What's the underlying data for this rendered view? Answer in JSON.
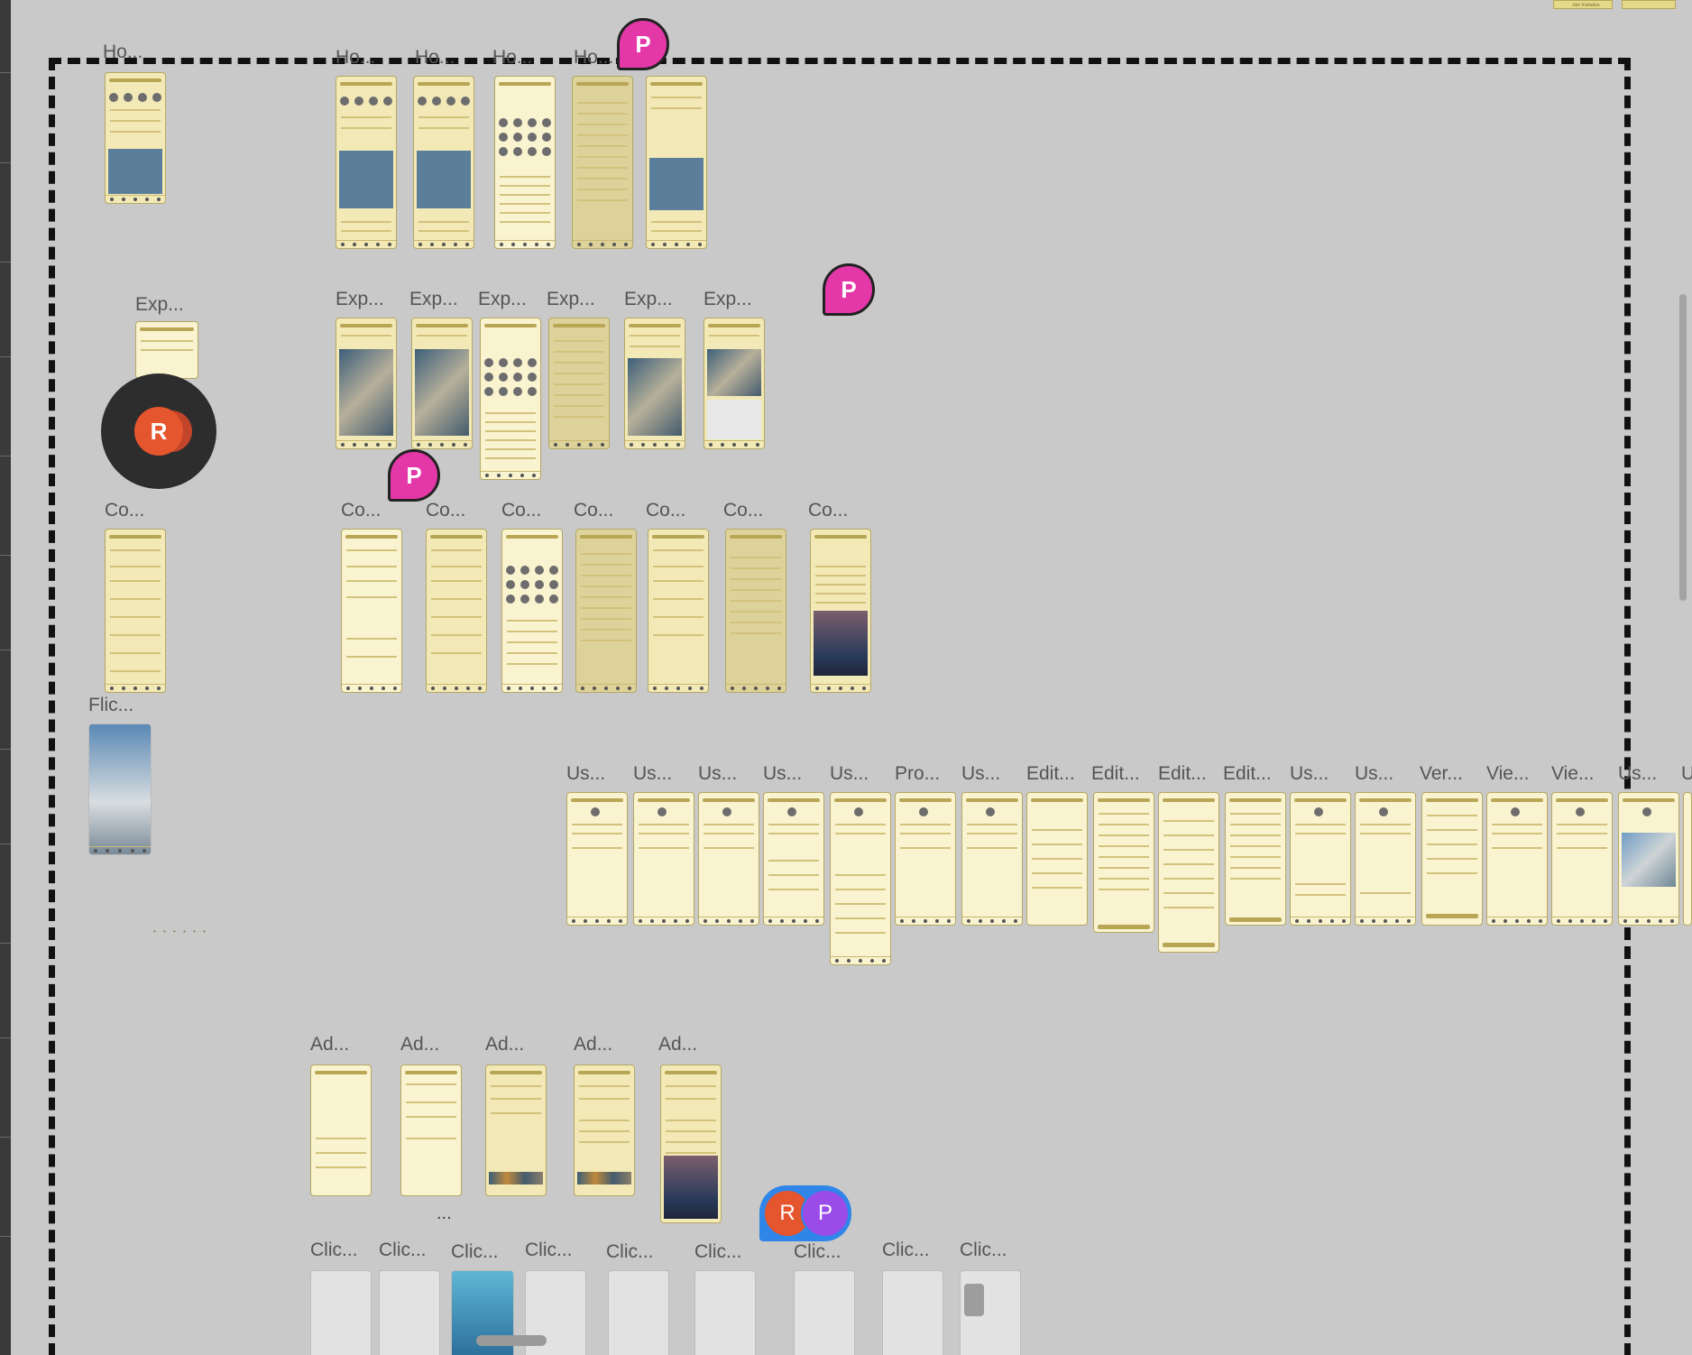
{
  "canvas": {
    "background": "#c9c9c9",
    "frame_style": "dashed"
  },
  "labels": {
    "home_1": "Ho...",
    "home_2": "Ho...",
    "home_3": "Ho...",
    "home_4": "Ho...",
    "home_5": "Ho...",
    "explore_1": "Exp...",
    "explore_2": "Exp...",
    "explore_3": "Exp...",
    "explore_4": "Exp...",
    "explore_5": "Exp...",
    "explore_6": "Exp...",
    "explore_7": "Exp...",
    "connection_1": "Co...",
    "connection_2": "Co...",
    "connection_3": "Co...",
    "connection_4": "Co...",
    "connection_5": "Co...",
    "connection_6": "Co...",
    "connection_7": "Co...",
    "connection_8": "Co...",
    "flick": "Flic...",
    "user_row": [
      "Us...",
      "Us...",
      "Us...",
      "Us...",
      "Us...",
      "Pro...",
      "Us...",
      "Edit...",
      "Edit...",
      "Edit...",
      "Edit...",
      "Us...",
      "Us...",
      "Ver...",
      "Vie...",
      "Vie...",
      "Us...",
      "U"
    ],
    "add_row": [
      "Ad...",
      "Ad...",
      "Ad...",
      "Ad...",
      "Ad..."
    ],
    "click_row": [
      "Clic...",
      "Clic...",
      "Clic...",
      "Clic...",
      "Clic...",
      "Clic...",
      "Clic...",
      "Clic...",
      "Clic..."
    ],
    "ellipsis": "..."
  },
  "collaborators": {
    "p_initial": "P",
    "r_initial": "R"
  },
  "colors": {
    "screen_fill": "#f2e9b6",
    "avatar_p": "#e437a8",
    "avatar_r": "#e5552e",
    "group_bg": "#2f86e8",
    "group_p": "#9a4be8"
  },
  "top_thumbs": {
    "first": "Join Invitation"
  }
}
